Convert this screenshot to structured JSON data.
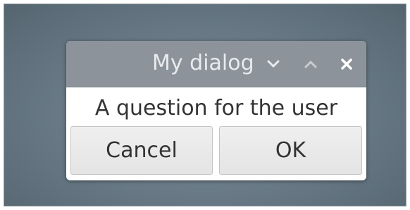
{
  "desktop": {
    "background_color": "#6b7c88"
  },
  "dialog": {
    "title": "My dialog",
    "titlebar_color": "#8c939a",
    "title_color": "#e8ebee",
    "controls": {
      "shade_icon": "chevron-down-icon",
      "maximize_icon": "chevron-up-icon",
      "close_icon": "close-icon"
    },
    "message": "A question for the user",
    "buttons": {
      "cancel_label": "Cancel",
      "ok_label": "OK"
    }
  }
}
